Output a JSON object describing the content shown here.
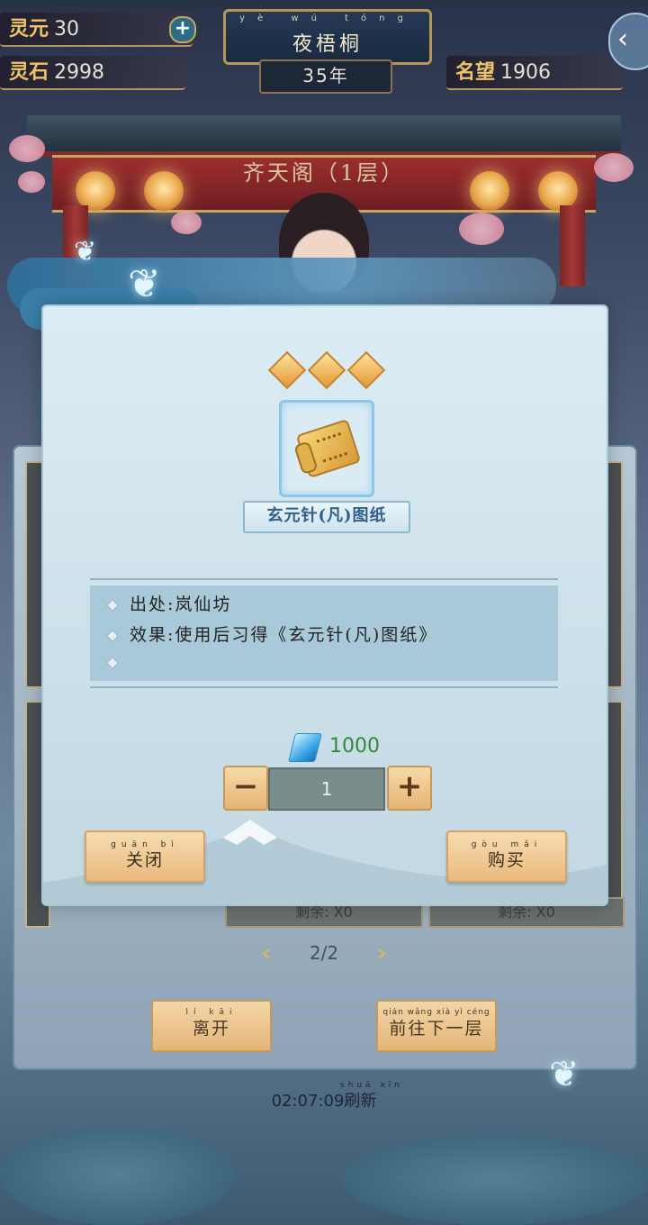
{
  "top_bar": {
    "lingyuan": {
      "label": "灵元",
      "value": "30"
    },
    "lingshi": {
      "label": "灵石",
      "value": "2998"
    },
    "mingwang": {
      "label": "名望",
      "value": "1906"
    },
    "player_name": "夜梧桐",
    "player_name_pinyin": "yè wú tóng",
    "year": "35年"
  },
  "scene": {
    "pavilion_title": "齐天阁（1层）"
  },
  "modal": {
    "star_count": 3,
    "item_name": "玄元针(凡)图纸",
    "description": [
      "出处:岚仙坊",
      "效果:使用后习得《玄元针(凡)图纸》",
      ""
    ],
    "price": "1000",
    "price_currency_icon": "crystal-icon",
    "quantity": "1",
    "minus_label": "−",
    "plus_label": "+",
    "close_button": {
      "label": "关闭",
      "pinyin": "guān bì"
    },
    "buy_button": {
      "label": "购买",
      "pinyin": "gòu mǎi"
    }
  },
  "shop": {
    "remaining_left": "剩余: X0",
    "remaining_right": "剩余: X0",
    "page": "2/2",
    "leave_button": {
      "label": "离开",
      "pinyin": "lí kāi"
    },
    "next_floor_button": {
      "label": "前往下一层",
      "pinyin": "qián wǎng xià yì céng"
    },
    "refresh_text": "02:07:09刷新",
    "refresh_pinyin": "shuā xīn"
  },
  "colors": {
    "accent_gold": "#c9a45c",
    "price_green": "#2d8a3a",
    "item_name_blue": "#2f5f8a"
  }
}
